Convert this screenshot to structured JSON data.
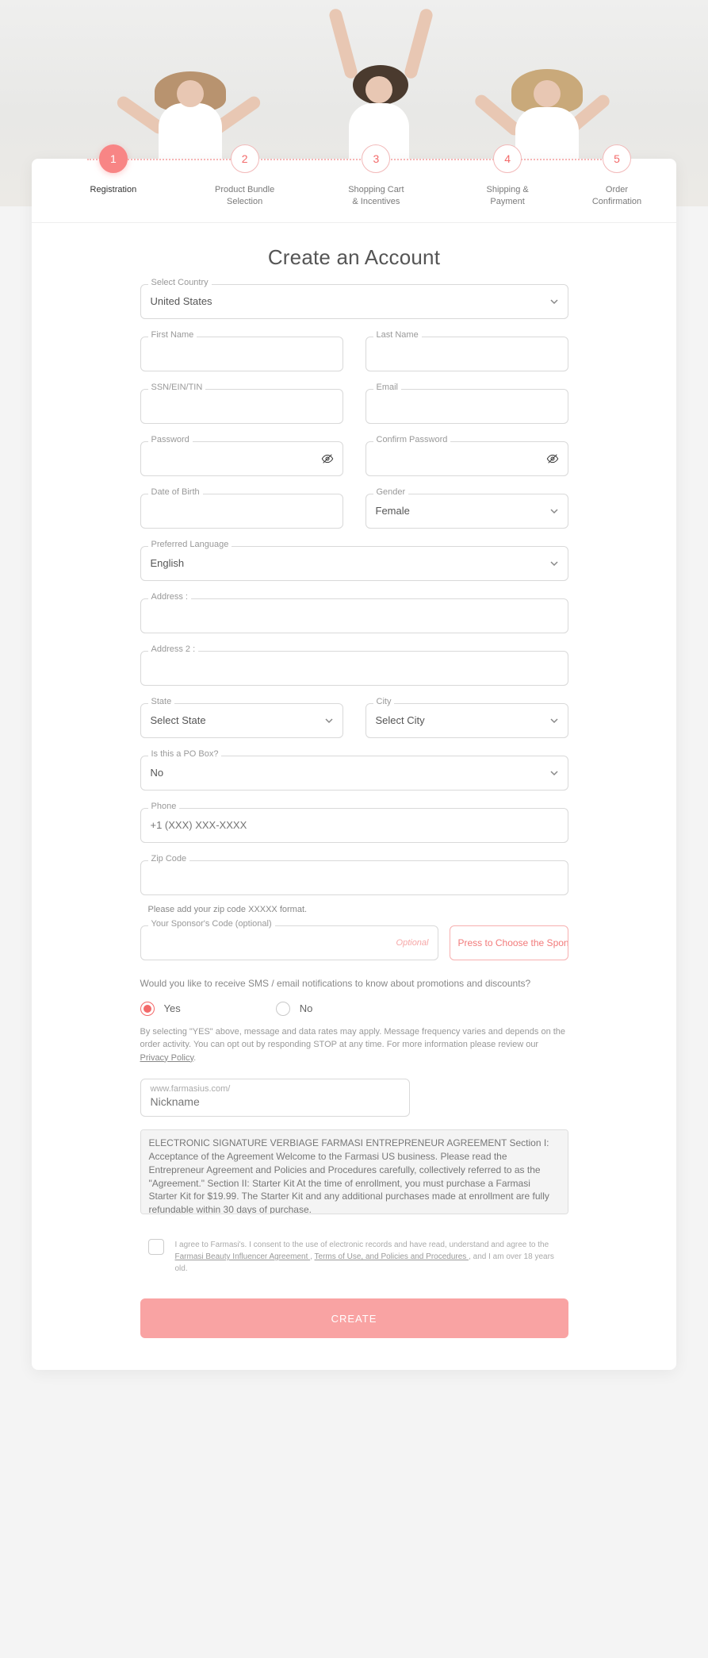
{
  "steps": [
    {
      "num": "1",
      "label": "Registration",
      "active": true
    },
    {
      "num": "2",
      "label": "Product Bundle\nSelection"
    },
    {
      "num": "3",
      "label": "Shopping Cart\n& Incentives"
    },
    {
      "num": "4",
      "label": "Shipping &\nPayment"
    },
    {
      "num": "5",
      "label": "Order\nConfirmation"
    }
  ],
  "title": "Create an Account",
  "fields": {
    "country": {
      "label": "Select Country",
      "value": "United States"
    },
    "first": {
      "label": "First Name"
    },
    "last": {
      "label": "Last Name"
    },
    "ssn": {
      "label": "SSN/EIN/TIN"
    },
    "email": {
      "label": "Email"
    },
    "pwd": {
      "label": "Password"
    },
    "cpwd": {
      "label": "Confirm Password"
    },
    "dob": {
      "label": "Date of Birth"
    },
    "gender": {
      "label": "Gender",
      "value": "Female"
    },
    "lang": {
      "label": "Preferred Language",
      "value": "English"
    },
    "addr": {
      "label": "Address :"
    },
    "addr2": {
      "label": "Address 2 :"
    },
    "state": {
      "label": "State",
      "value": "Select State"
    },
    "city": {
      "label": "City",
      "value": "Select City"
    },
    "po": {
      "label": "Is this a PO Box?",
      "value": "No"
    },
    "phone": {
      "label": "Phone",
      "placeholder": "+1 (XXX) XXX-XXXX"
    },
    "zip": {
      "label": "Zip Code",
      "helper": "Please add your zip code XXXXX format."
    },
    "sponsor": {
      "label": "Your Sponsor's Code (optional)",
      "hint": "Optional",
      "button": "Press to Choose the Sponsor"
    }
  },
  "notify": {
    "q": "Would you like to receive SMS / email notifications to know about promotions and discounts?",
    "yes": "Yes",
    "no": "No",
    "fine_a": "By selecting \"YES\" above, message and data rates may apply. Message frequency varies and depends on the order activity. You can opt out by responding STOP at any time. For more information please review our ",
    "fine_link": "Privacy Policy",
    "fine_b": "."
  },
  "nickname": {
    "prefix": "www.farmasius.com/",
    "placeholder": "Nickname"
  },
  "agreement": "ELECTRONIC SIGNATURE VERBIAGE FARMASI ENTREPRENEUR AGREEMENT Section I: Acceptance of the Agreement Welcome to the Farmasi US business. Please read the Entrepreneur Agreement and Policies and Procedures carefully, collectively referred to as the \"Agreement.\" Section II: Starter Kit At the time of enrollment, you must purchase a Farmasi Starter Kit for $19.99. The Starter Kit and any additional purchases made at enrollment are fully refundable within 30 days of purchase.",
  "consent": {
    "a": "I agree to Farmasi's. I consent to the use of electronic records and have read, understand and agree to the ",
    "l1": "Farmasi Beauty Influencer Agreement ",
    "m": ", ",
    "l2": "Terms of Use, and Policies and Procedures ",
    "b": ", and I am over 18 years old."
  },
  "create": "CREATE"
}
